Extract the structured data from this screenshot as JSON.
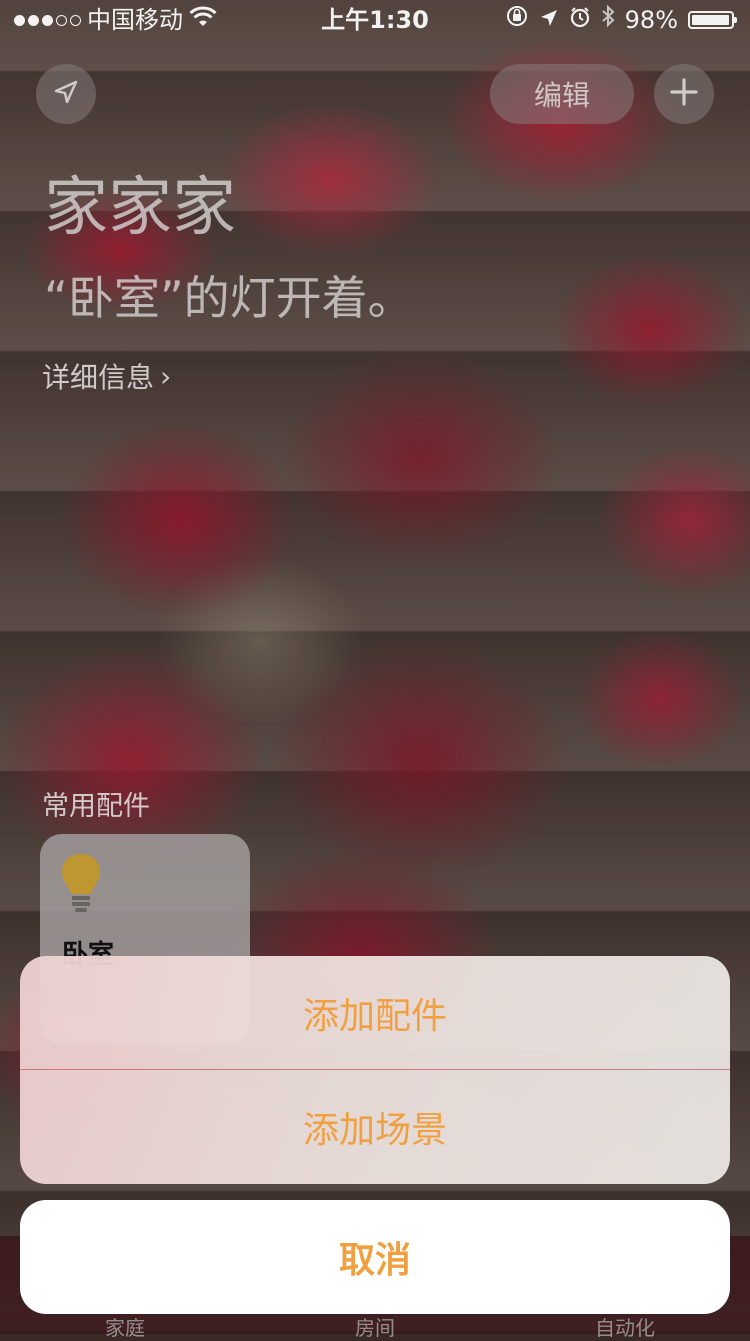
{
  "status_bar": {
    "carrier": "中国移动",
    "time": "上午1:30",
    "battery_percent_label": "98%",
    "battery_level": 0.98,
    "signal_bars_filled": 3,
    "signal_bars_total": 5,
    "icons": [
      "wifi-icon",
      "orientation-lock-icon",
      "location-icon",
      "alarm-icon",
      "bluetooth-icon",
      "battery-icon"
    ]
  },
  "toolbar": {
    "location_icon": "location-arrow-icon",
    "edit_label": "编辑",
    "add_icon": "plus-icon"
  },
  "home": {
    "title": "家家家",
    "status": "“卧室”的灯开着。",
    "details_link": "详细信息",
    "details_chevron": "›"
  },
  "favorites": {
    "section_label": "常用配件",
    "tiles": [
      {
        "name": "卧室",
        "icon": "lightbulb-icon"
      }
    ]
  },
  "tab_bar": {
    "tabs": [
      {
        "label": "家庭"
      },
      {
        "label": "房间"
      },
      {
        "label": "自动化"
      }
    ]
  },
  "action_sheet": {
    "actions": [
      {
        "label": "添加配件"
      },
      {
        "label": "添加场景"
      }
    ],
    "cancel_label": "取消",
    "accent_color": "#f0a040"
  }
}
